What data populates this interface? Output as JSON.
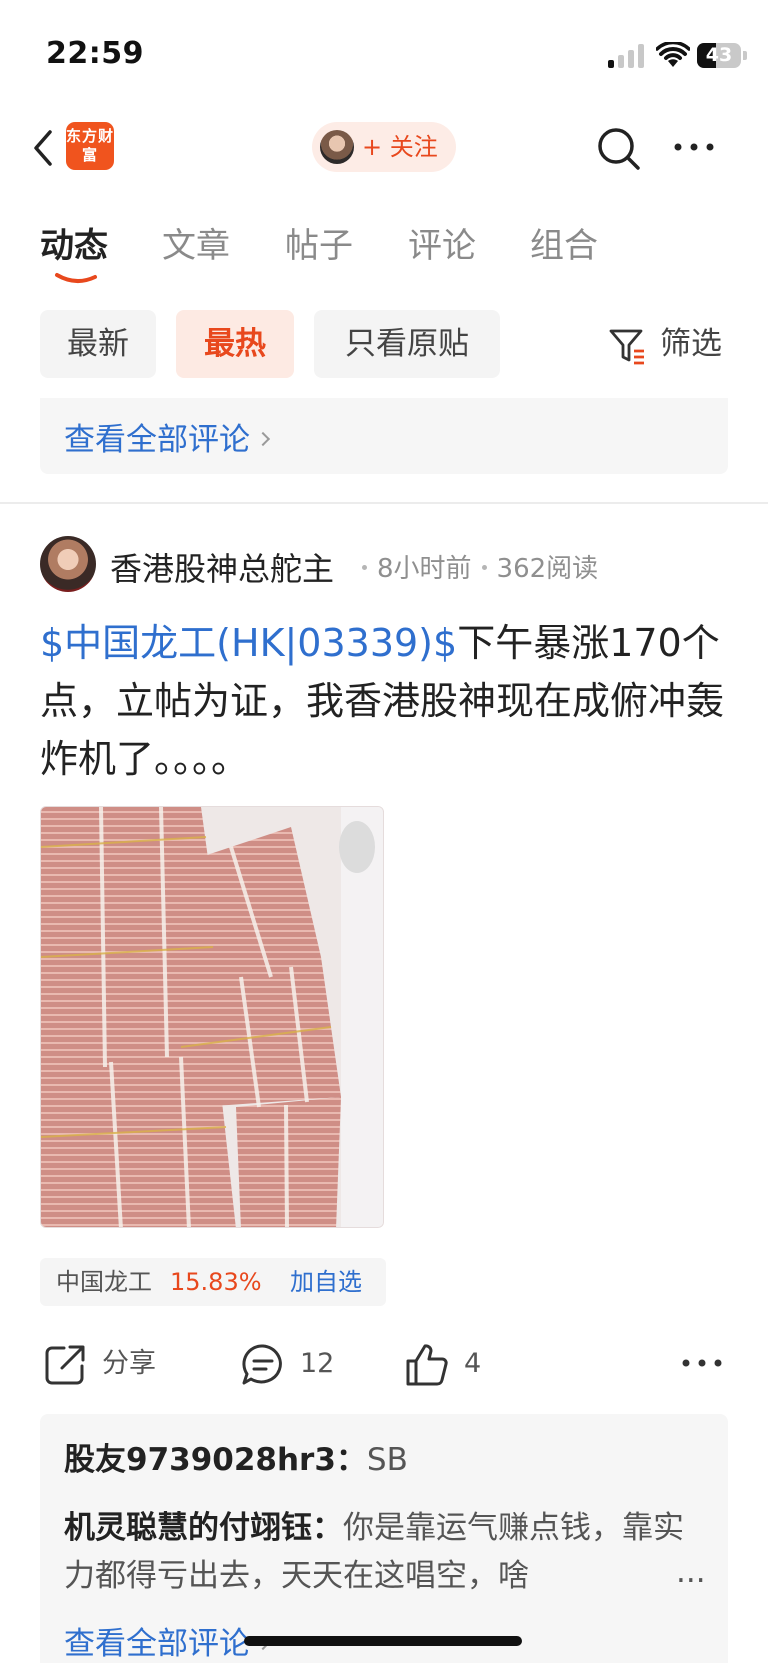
{
  "status_bar": {
    "time": "22:59",
    "battery": "43",
    "battery_level": 0.43
  },
  "header": {
    "logo_text": "东方财富",
    "follow_label": "+ 关注",
    "icons": [
      "chevron-left-icon",
      "search-icon",
      "more-icon"
    ]
  },
  "tabs": [
    {
      "label": "动态",
      "active": true
    },
    {
      "label": "文章",
      "active": false
    },
    {
      "label": "帖子",
      "active": false
    },
    {
      "label": "评论",
      "active": false
    },
    {
      "label": "组合",
      "active": false
    }
  ],
  "filters": {
    "chips": [
      {
        "label": "最新",
        "active": false
      },
      {
        "label": "最热",
        "active": true
      },
      {
        "label": "只看原贴",
        "active": false
      }
    ],
    "filter_label": "筛选"
  },
  "previous": {
    "view_all": "查看全部评论"
  },
  "post": {
    "author": "香港股神总舵主",
    "time": "8小时前",
    "reads": "362阅读",
    "stock_tag": "$中国龙工(HK|03339)$",
    "body": "下午暴涨170个点，立帖为证，我香港股神现在成俯冲轰炸机了。。。。",
    "stock": {
      "name": "中国龙工",
      "change": "15.83%",
      "add": "加自选"
    },
    "actions": {
      "share": "分享",
      "comments": "12",
      "likes": "4"
    }
  },
  "comments": [
    {
      "user": "股友9739028hr3：",
      "text": "SB"
    },
    {
      "user": "机灵聪慧的付翊钰：",
      "text": "你是靠运气赚点钱，靠实力都得亏出去，天天在这唱空，啥"
    }
  ],
  "comments_ellipsis": "...",
  "comments_view_all": "查看全部评论",
  "colors": {
    "accent": "#e8481d",
    "link": "#2f6fce",
    "brand": "#f0541e"
  }
}
